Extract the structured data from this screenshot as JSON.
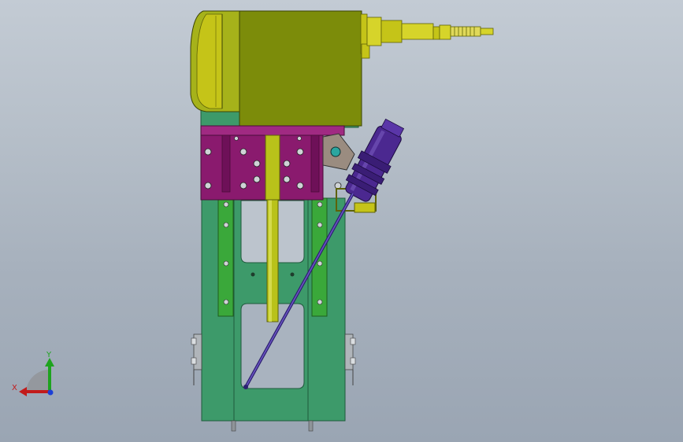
{
  "scene": {
    "background_top": "#c3cbd4",
    "background_bottom": "#9aa5b3",
    "colors": {
      "frame_green": "#3d9a6a",
      "rail_green": "#3aa83a",
      "motor_olive": "#7c8c0a",
      "motor_gold": "#c5c418",
      "carriage_magenta": "#8a1a6e",
      "valve_purple": "#4b2890",
      "rod_yellow": "#b9c21a"
    },
    "parts": [
      "motor-housing-icon",
      "fitting-icon",
      "carriage-plate-icon",
      "guide-rail-icon",
      "base-frame-icon",
      "lead-rod-icon",
      "valve-cylinder-icon",
      "diagonal-link-icon",
      "clamp-icon",
      "bolt-icon"
    ]
  },
  "triad": {
    "x_label": "X",
    "y_label": "Y",
    "x_color": "#c21b1b",
    "y_color": "#1ea31e",
    "z_color": "#1c3fd6"
  }
}
